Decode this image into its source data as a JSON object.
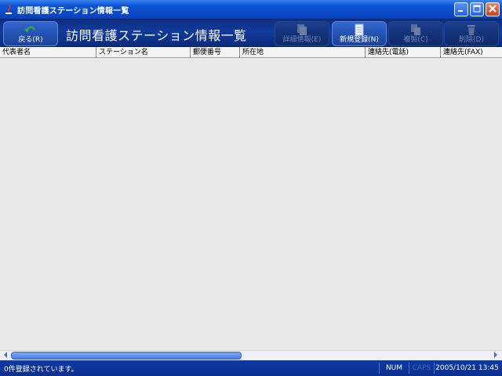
{
  "window": {
    "title": "訪問看護ステーション情報一覧",
    "minimize_icon": "minimize-icon",
    "maximize_icon": "maximize-icon",
    "close_icon": "close-icon"
  },
  "toolbar": {
    "back_label": "戻る(R)",
    "page_title": "訪問看護ステーション情報一覧",
    "detail_label": "詳細情報(E)",
    "new_label": "新規登録(N)",
    "copy_label": "複製(C)",
    "delete_label": "削除(D)"
  },
  "table": {
    "columns": [
      "代表者名",
      "ステーション名",
      "郵便番号",
      "所在地",
      "連絡先(電話)",
      "連絡先(FAX)"
    ],
    "rows": []
  },
  "statusbar": {
    "message": "0件登録されています。",
    "num": "NUM",
    "caps": "CAPS",
    "datetime": "2005/10/21 13:45"
  },
  "colors": {
    "titlebar": "#0c54d6",
    "toolbar": "#103a9c",
    "statusbar": "#0d3aa5"
  }
}
